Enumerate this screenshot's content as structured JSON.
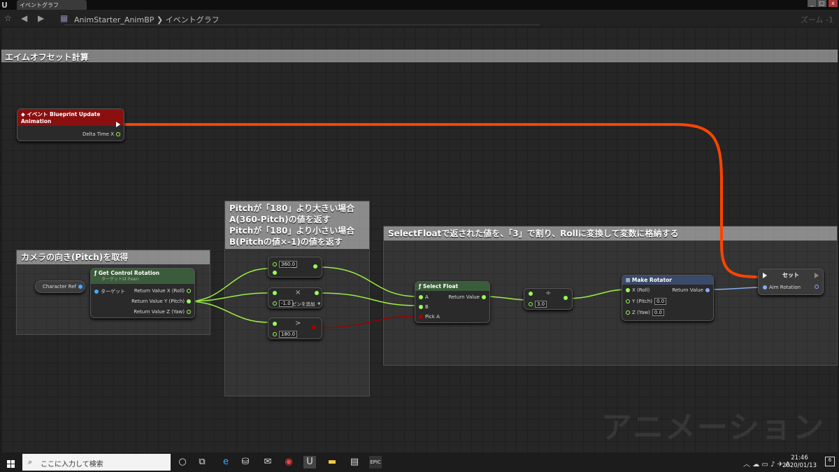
{
  "window": {
    "tab_title": "イベントグラフ",
    "min": "_",
    "max": "□",
    "close": "x"
  },
  "toolbar": {
    "star": "☆",
    "back": "◀",
    "forward": "▶",
    "breadcrumb": "AnimStarter_AnimBP ❯ イベントグラフ",
    "zoom": "ズーム -1"
  },
  "graph": {
    "title_bar": "エイムオフセット計算",
    "watermark": "アニメーション",
    "comments": {
      "camera": "カメラの向き(Pitch)を取得",
      "pitch": [
        "Pitchが「180」より大きい場合",
        "A(360-Pitch)の値を返す",
        "Pitchが「180」より小さい場合",
        "B(Pitchの値×-1)の値を返す"
      ],
      "select": "SelectFloatで返された値を、「3」で割り、Rollに変換して変数に格納する"
    },
    "nodes": {
      "event": {
        "title": "イベント Blueprint Update Animation",
        "pin": "Delta Time X"
      },
      "char_ref": {
        "label": "Character Ref"
      },
      "get_rot": {
        "title": "Get Control Rotation",
        "subtitle": "ターゲットは Pawn",
        "target": "ターゲット",
        "rx": "Return Value X (Roll)",
        "ry": "Return Value Y (Pitch)",
        "rz": "Return Value Z (Yaw)"
      },
      "minus": {
        "value": "360.0",
        "op": "−"
      },
      "mult": {
        "value": "-1.0",
        "op": "×",
        "add_pin": "ピンを追加"
      },
      "greater": {
        "value": "180.0",
        "op": ">"
      },
      "select": {
        "title": "Select Float",
        "a": "A",
        "b": "B",
        "pick": "Pick A",
        "ret": "Return Value"
      },
      "divide": {
        "value": "3.0",
        "op": "÷"
      },
      "make_rot": {
        "title": "Make Rotator",
        "x": "X (Roll)",
        "y": "Y (Pitch)",
        "yv": "0.0",
        "z": "Z (Yaw)",
        "zv": "0.0",
        "ret": "Return Value"
      },
      "set": {
        "title": "セット",
        "pin": "Aim Rotation"
      }
    }
  },
  "taskbar": {
    "search_placeholder": "ここに入力して検索",
    "time": "21:46",
    "date": "2020/01/13",
    "notif_count": "6",
    "epic": "EPIC"
  }
}
